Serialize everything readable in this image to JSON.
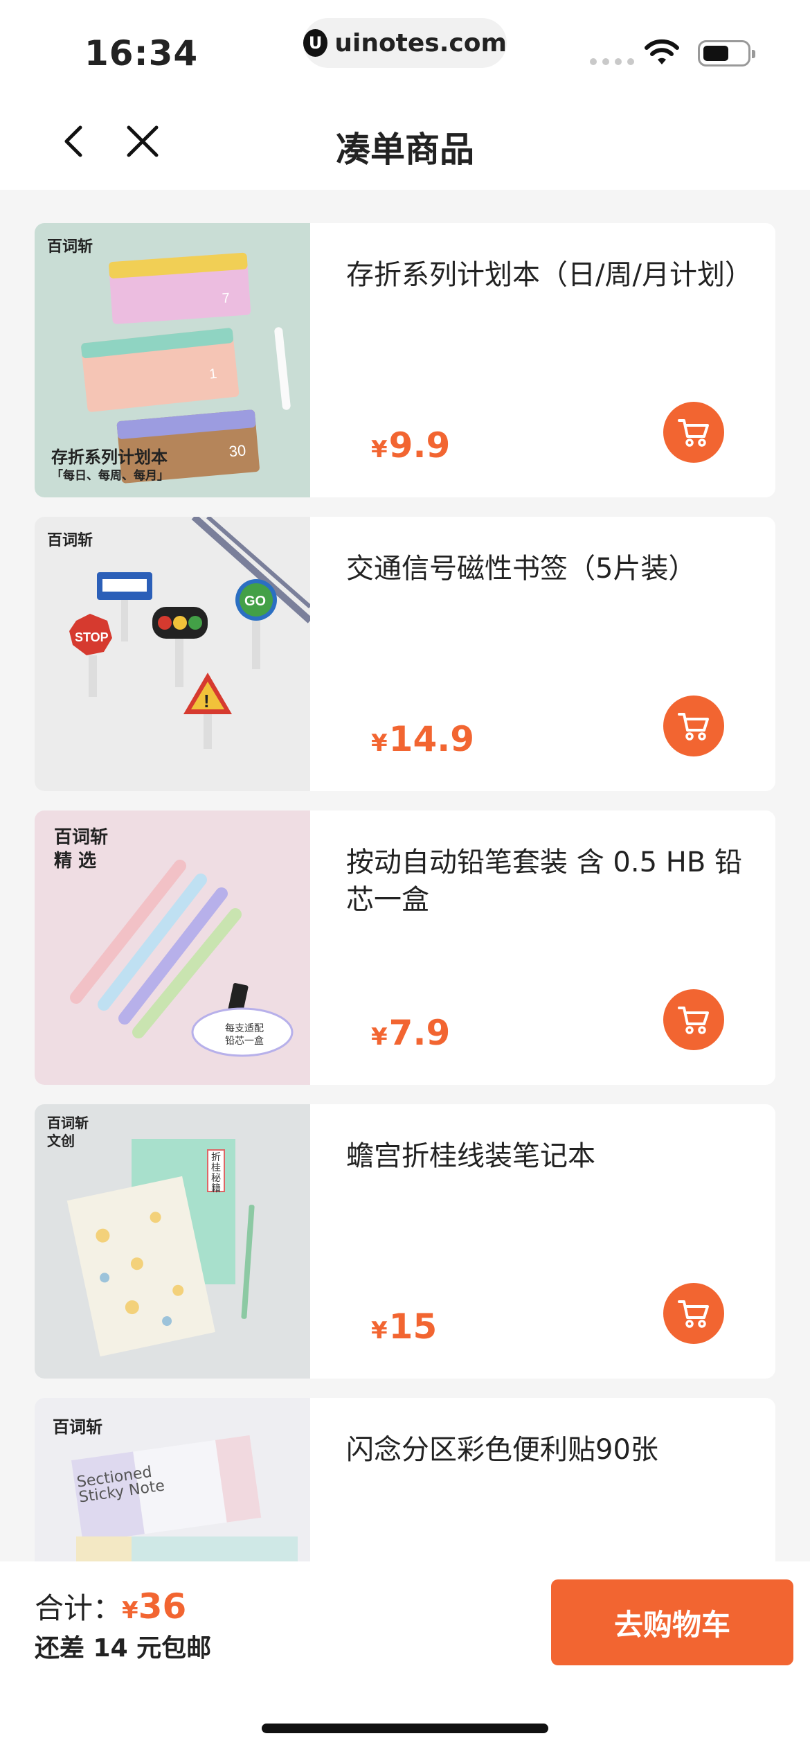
{
  "status_bar": {
    "time": "16:34",
    "url": "uinotes.com"
  },
  "nav": {
    "title": "凑单商品"
  },
  "products": [
    {
      "name": "存折系列计划本（日/周/月计划）",
      "currency": "¥",
      "price": "9.9",
      "brand": "百词斩",
      "image_text": "存折系列计划本",
      "image_sub": "「每日、每周、每月」"
    },
    {
      "name": "交通信号磁性书签（5片装）",
      "currency": "¥",
      "price": "14.9",
      "brand": "百词斩"
    },
    {
      "name": "按动自动铅笔套装 含 0.5 HB 铅芯一盒",
      "currency": "¥",
      "price": "7.9",
      "brand": "百词斩 精 选",
      "image_text": "每支适配 铅芯一盒"
    },
    {
      "name": "蟾宫折桂线装笔记本",
      "currency": "¥",
      "price": "15",
      "brand": "百词斩 文创",
      "image_text": "折桂秘籍"
    },
    {
      "name": "闪念分区彩色便利贴90张",
      "currency": "¥",
      "price": "",
      "brand": "百词斩",
      "image_text": "Sectioned Sticky Note"
    }
  ],
  "footer": {
    "total_label": "合计：",
    "currency": "¥",
    "total": "36",
    "shipping_note": "还差 14 元包邮",
    "go_cart_label": "去购物车"
  },
  "colors": {
    "accent": "#f26531",
    "background": "#f5f5f5"
  }
}
